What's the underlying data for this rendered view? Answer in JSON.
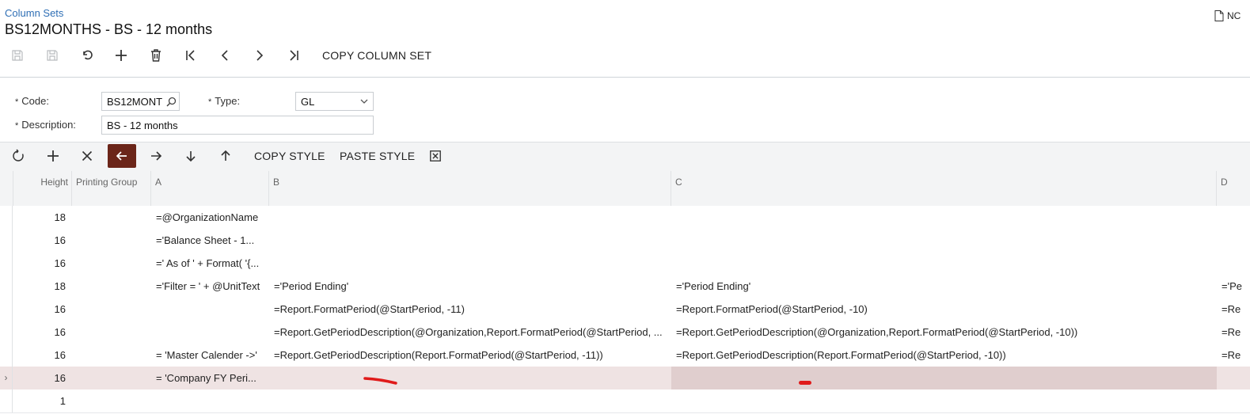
{
  "header": {
    "breadcrumb": "Column Sets",
    "title": "BS12MONTHS - BS - 12 months",
    "notes_label": "NC"
  },
  "toolbar": {
    "copy_column_set_label": "COPY COLUMN SET"
  },
  "form": {
    "code_label": "Code:",
    "code_value": "BS12MONT",
    "type_label": "Type:",
    "type_value": "GL",
    "description_label": "Description:",
    "description_value": "BS  - 12 months",
    "required_marker": "*"
  },
  "grid_toolbar": {
    "copy_style_label": "COPY STYLE",
    "paste_style_label": "PASTE STYLE"
  },
  "grid": {
    "headers": {
      "height": "Height",
      "printing_group": "Printing Group",
      "a": "A",
      "b": "B",
      "c": "C",
      "d": "D"
    },
    "rows": [
      {
        "height": "18",
        "group": "",
        "a": "=@OrganizationName",
        "b": "",
        "c": "",
        "d": ""
      },
      {
        "height": "16",
        "group": "",
        "a": "='Balance Sheet - 1...",
        "b": "",
        "c": "",
        "d": ""
      },
      {
        "height": "16",
        "group": "",
        "a": "=' As of ' + Format( '{...",
        "b": "",
        "c": "",
        "d": ""
      },
      {
        "height": "18",
        "group": "",
        "a": "='Filter = ' + @UnitText",
        "b": "='Period Ending'",
        "c": "='Period Ending'",
        "d": "='Pe"
      },
      {
        "height": "16",
        "group": "",
        "a": "",
        "b": "=Report.FormatPeriod(@StartPeriod, -11)",
        "c": "=Report.FormatPeriod(@StartPeriod, -10)",
        "d": "=Re"
      },
      {
        "height": "16",
        "group": "",
        "a": "",
        "b": "=Report.GetPeriodDescription(@Organization,Report.FormatPeriod(@StartPeriod, ...",
        "c": "=Report.GetPeriodDescription(@Organization,Report.FormatPeriod(@StartPeriod, -10))",
        "d": "=Re"
      },
      {
        "height": "16",
        "group": "",
        "a": "= 'Master Calender ->'",
        "b": "=Report.GetPeriodDescription(Report.FormatPeriod(@StartPeriod, -11))",
        "c": "=Report.GetPeriodDescription(Report.FormatPeriod(@StartPeriod, -10))",
        "d": "=Re"
      },
      {
        "height": "16",
        "group": "",
        "a": "= 'Company FY Peri...",
        "b": "",
        "c": "",
        "d": ""
      },
      {
        "height": "1",
        "group": "",
        "a": "",
        "b": "",
        "c": "",
        "d": ""
      }
    ],
    "selected_row_indicator": "›"
  },
  "colors": {
    "accent": "#6b2519",
    "link": "#2f6fb5",
    "selected_row": "#efe3e3",
    "selected_cell": "#e0cece",
    "annotation": "#e01a1a"
  }
}
